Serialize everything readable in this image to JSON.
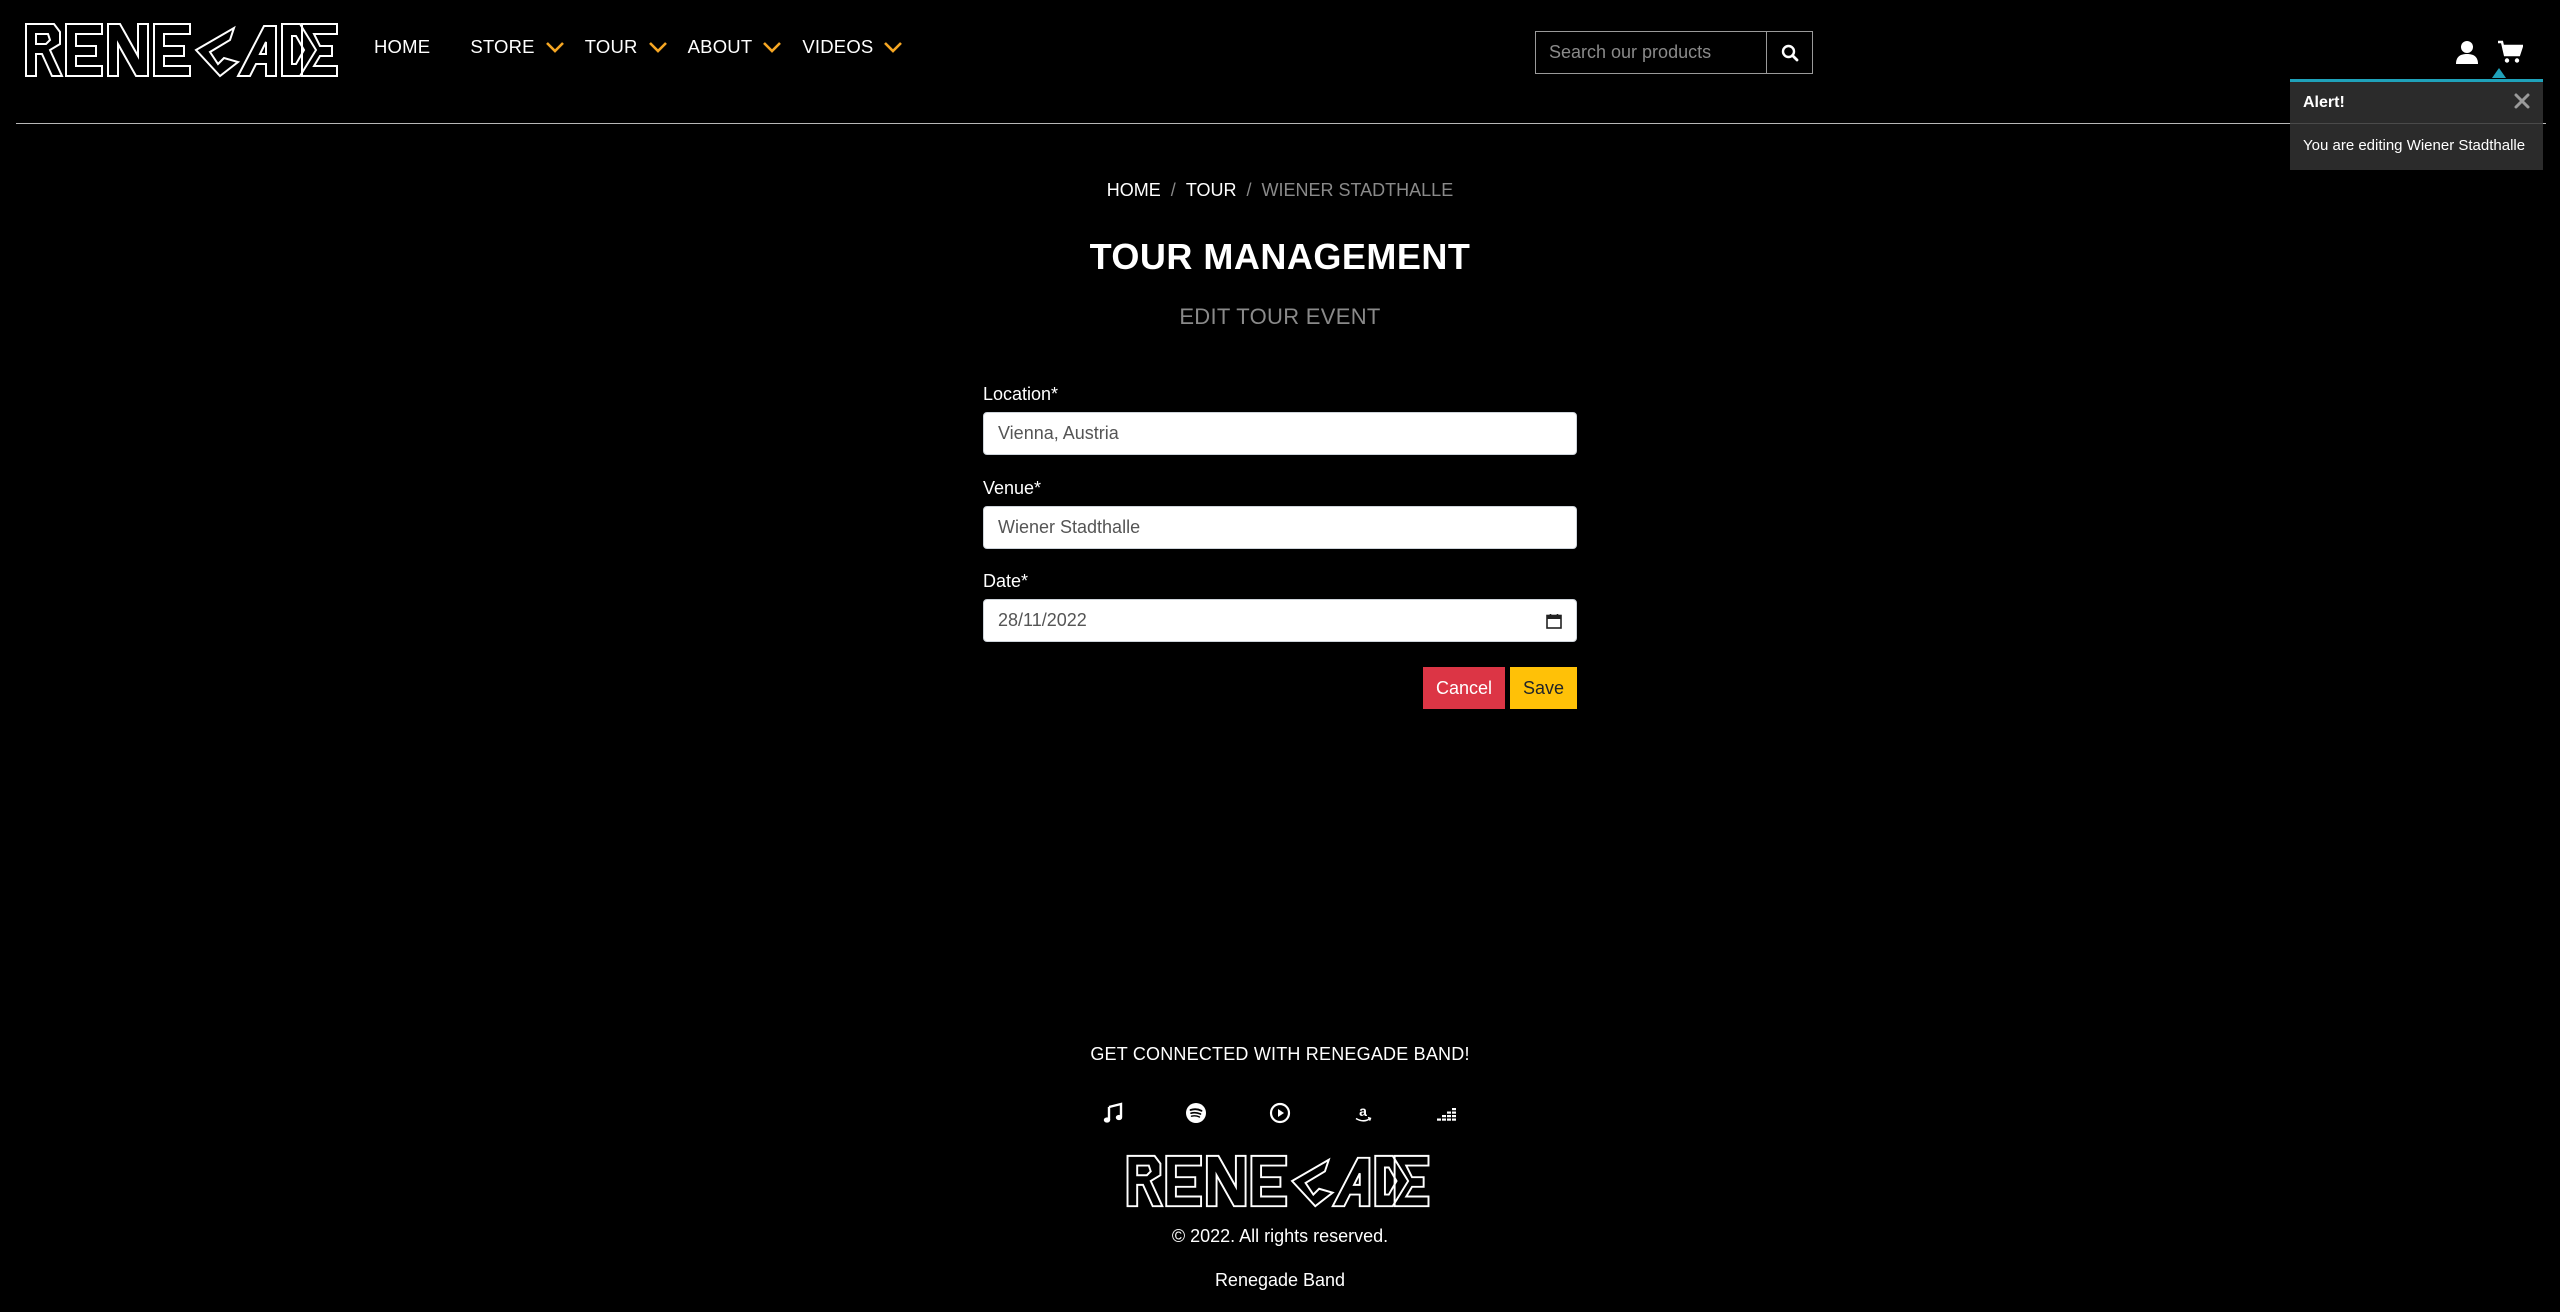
{
  "brand": {
    "logo_text": "RENEGADE"
  },
  "nav": {
    "home": "HOME",
    "store": "STORE",
    "tour": "TOUR",
    "about": "ABOUT",
    "videos": "VIDEOS"
  },
  "search": {
    "placeholder": "Search our products"
  },
  "alert": {
    "title": "Alert!",
    "message": "You are editing Wiener Stadthalle"
  },
  "breadcrumb": {
    "home": "HOME",
    "tour": "TOUR",
    "current": "WIENER STADTHALLE",
    "separator": "/"
  },
  "page": {
    "title": "TOUR MANAGEMENT",
    "subtitle": "EDIT TOUR EVENT"
  },
  "form": {
    "location_label": "Location*",
    "location_value": "Vienna, Austria",
    "venue_label": "Venue*",
    "venue_value": "Wiener Stadthalle",
    "date_label": "Date*",
    "date_value": "28/11/2022",
    "cancel_label": "Cancel",
    "save_label": "Save"
  },
  "footer": {
    "connect": "GET CONNECTED WITH RENEGADE BAND!",
    "copyright": "© 2022. All rights reserved.",
    "band_name": "Renegade Band",
    "social_icons": [
      "apple-music-icon",
      "spotify-icon",
      "youtube-music-icon",
      "amazon-icon",
      "deezer-icon"
    ]
  },
  "colors": {
    "accent_orange": "#f5a623",
    "cancel_red": "#dc3545",
    "save_yellow": "#ffc107",
    "alert_border": "#1fa2ba"
  }
}
